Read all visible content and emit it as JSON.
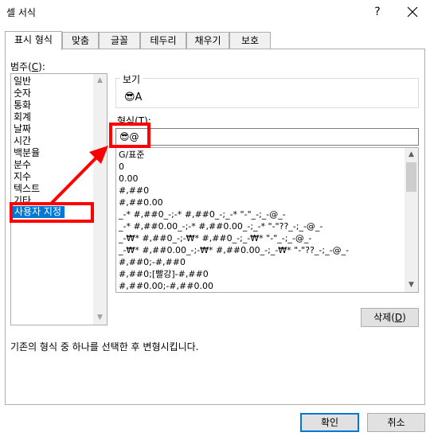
{
  "window": {
    "title": "셀 서식",
    "help_label": "?",
    "close_icon": "close-icon"
  },
  "tabs": [
    {
      "label": "표시 형식",
      "active": true
    },
    {
      "label": "맞춤",
      "active": false
    },
    {
      "label": "글꼴",
      "active": false
    },
    {
      "label": "테두리",
      "active": false
    },
    {
      "label": "채우기",
      "active": false
    },
    {
      "label": "보호",
      "active": false
    }
  ],
  "category": {
    "label_prefix": "범주(",
    "label_key": "C",
    "label_suffix": "):",
    "items": [
      "일반",
      "숫자",
      "통화",
      "회계",
      "날짜",
      "시간",
      "백분율",
      "분수",
      "지수",
      "텍스트",
      "기타",
      "사용자 지정"
    ],
    "selected": "사용자 지정"
  },
  "preview": {
    "legend": "보기",
    "sample": "😎A"
  },
  "format": {
    "label_prefix": "형식(",
    "label_key": "T",
    "label_suffix": "):",
    "value": "😎@",
    "items": [
      "G/표준",
      "0",
      "0.00",
      "#,##0",
      "#,##0.00",
      "_-* #,##0_-;-* #,##0_-;_-* \"-\"_-;_-@_-",
      "_-* #,##0.00_-;-* #,##0.00_-;_-* \"-\"??_-;_-@_-",
      "_-₩* #,##0_-;-₩* #,##0_-;_-₩* \"-\"_-;_-@_-",
      "_-₩* #,##0.00_-;-₩* #,##0.00_-;_-₩* \"-\"??_-;_-@_-",
      "#,##0;-#,##0",
      "#,##0;[빨강]-#,##0",
      "#,##0.00;-#,##0.00"
    ]
  },
  "delete_button": {
    "label_prefix": "삭제(",
    "label_key": "D",
    "label_suffix": ")"
  },
  "description": "기존의 형식 중 하나를 선택한 후 변형시킵니다.",
  "ok_button": {
    "label": "확인"
  },
  "cancel_button": {
    "label": "취소"
  },
  "colors": {
    "highlight": "#ff0000",
    "selection": "#0078d7"
  }
}
